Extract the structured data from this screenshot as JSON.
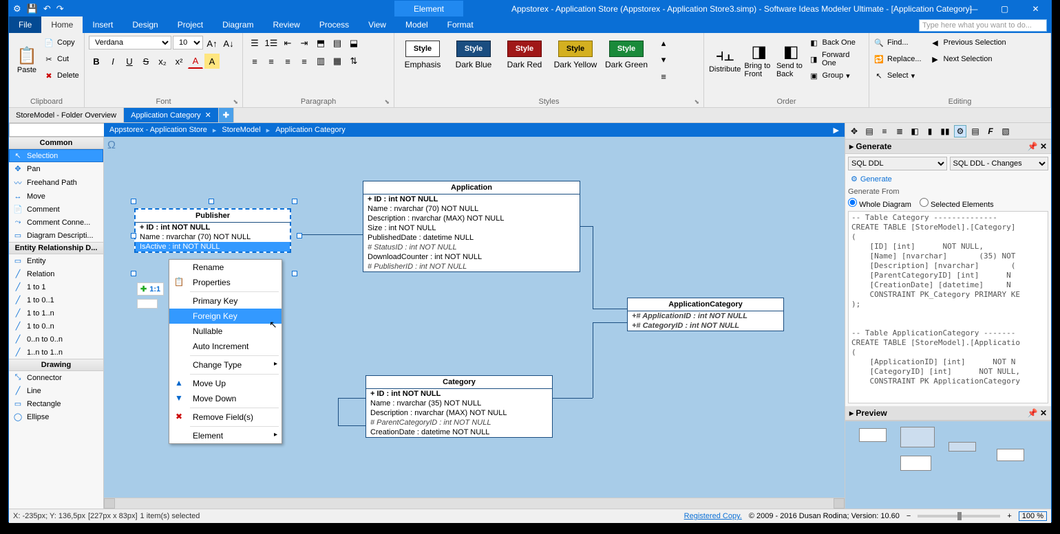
{
  "titlebar": {
    "context_tab": "Element",
    "title": "Appstorex - Application Store (Appstorex - Application Store3.simp)  - Software Ideas Modeler Ultimate - [Application Category]"
  },
  "menubar": {
    "file": "File",
    "home": "Home",
    "insert": "Insert",
    "design": "Design",
    "project": "Project",
    "diagram": "Diagram",
    "review": "Review",
    "process": "Process",
    "view": "View",
    "model": "Model",
    "format": "Format"
  },
  "ribbon": {
    "tellme_placeholder": "Type here what you want to do...",
    "clipboard": {
      "label": "Clipboard",
      "paste": "Paste",
      "copy": "Copy",
      "cut": "Cut",
      "delete": "Delete"
    },
    "font": {
      "label": "Font",
      "family": "Verdana",
      "size": "10"
    },
    "paragraph": {
      "label": "Paragraph"
    },
    "styles": {
      "label": "Styles",
      "items": [
        "Emphasis",
        "Dark Blue",
        "Dark Red",
        "Dark Yellow",
        "Dark Green"
      ]
    },
    "order": {
      "label": "Order",
      "distribute": "Distribute",
      "bring_front": "Bring to Front",
      "send_back": "Send to Back",
      "back_one": "Back One",
      "forward_one": "Forward One",
      "group": "Group"
    },
    "editing": {
      "label": "Editing",
      "find": "Find...",
      "replace": "Replace...",
      "select": "Select",
      "prev_sel": "Previous Selection",
      "next_sel": "Next Selection"
    }
  },
  "doc_tabs": {
    "tab1": "StoreModel - Folder Overview",
    "tab2": "Application Category"
  },
  "breadcrumb": {
    "a": "Appstorex - Application Store",
    "b": "StoreModel",
    "c": "Application Category"
  },
  "tools": {
    "h_common": "Common",
    "selection": "Selection",
    "pan": "Pan",
    "freehand": "Freehand Path",
    "move": "Move",
    "comment": "Comment",
    "comment_conn": "Comment Conne...",
    "diag_desc": "Diagram Descripti...",
    "h_erd": "Entity Relationship D...",
    "entity": "Entity",
    "relation": "Relation",
    "r11": "1 to 1",
    "r101": "1 to 0..1",
    "r11n": "1 to 1..n",
    "r10n": "1 to 0..n",
    "r0n0n": "0..n to 0..n",
    "r1n1n": "1..n to 1..n",
    "h_drawing": "Drawing",
    "connector": "Connector",
    "line": "Line",
    "rectangle": "Rectangle",
    "ellipse": "Ellipse"
  },
  "entities": {
    "publisher": {
      "title": "Publisher",
      "rows": [
        "+ ID : int NOT NULL",
        "Name : nvarchar (70)  NOT NULL",
        "IsActive : int NOT NULL"
      ]
    },
    "application": {
      "title": "Application",
      "rows": [
        "+ ID : int NOT NULL",
        "Name : nvarchar (70)  NOT NULL",
        "Description : nvarchar (MAX)  NOT NULL",
        "Size : int NOT NULL",
        "PublishedDate : datetime NULL",
        "# StatusID : int NOT NULL",
        "DownloadCounter : int NOT NULL",
        "# PublisherID : int NOT NULL"
      ]
    },
    "appcat": {
      "title": "ApplicationCategory",
      "rows": [
        "+# ApplicationID : int NOT NULL",
        "+# CategoryID : int NOT NULL"
      ]
    },
    "category": {
      "title": "Category",
      "rows": [
        "+ ID : int NOT NULL",
        "Name : nvarchar (35)  NOT NULL",
        "Description : nvarchar (MAX)  NOT NULL",
        "# ParentCategoryID : int NOT NULL",
        "CreationDate : datetime NOT NULL"
      ]
    }
  },
  "helper": {
    "text": "1:1"
  },
  "context_menu": {
    "rename": "Rename",
    "properties": "Properties",
    "primary": "Primary Key",
    "foreign": "Foreign Key",
    "nullable": "Nullable",
    "autoinc": "Auto Increment",
    "change_type": "Change Type",
    "move_up": "Move Up",
    "move_down": "Move Down",
    "remove": "Remove Field(s)",
    "element": "Element"
  },
  "right": {
    "generate_header": "Generate",
    "ddl1": "SQL DDL",
    "ddl2": "SQL DDL - Changes",
    "gen_btn": "Generate",
    "gen_from": "Generate From",
    "whole": "Whole Diagram",
    "selected": "Selected Elements",
    "preview_header": "Preview",
    "code": "-- Table Category --------------\nCREATE TABLE [StoreModel].[Category]\n(\n    [ID] [int]      NOT NULL,\n    [Name] [nvarchar]       (35) NOT\n    [Description] [nvarchar]       (\n    [ParentCategoryID] [int]      N\n    [CreationDate] [datetime]     N\n    CONSTRAINT PK_Category PRIMARY KE\n);\n\n\n-- Table ApplicationCategory -------\nCREATE TABLE [StoreModel].[Applicatio\n(\n    [ApplicationID] [int]      NOT N\n    [CategoryID] [int]      NOT NULL,\n    CONSTRAINT PK ApplicationCategory"
  },
  "status": {
    "coords": "X: -235px; Y: 136,5px",
    "size": "[227px x 83px]",
    "sel": "1 item(s) selected",
    "registered": "Registered Copy.",
    "copyright": "© 2009 - 2016 Dusan Rodina; Version: 10.60",
    "zoom": "100 %"
  }
}
